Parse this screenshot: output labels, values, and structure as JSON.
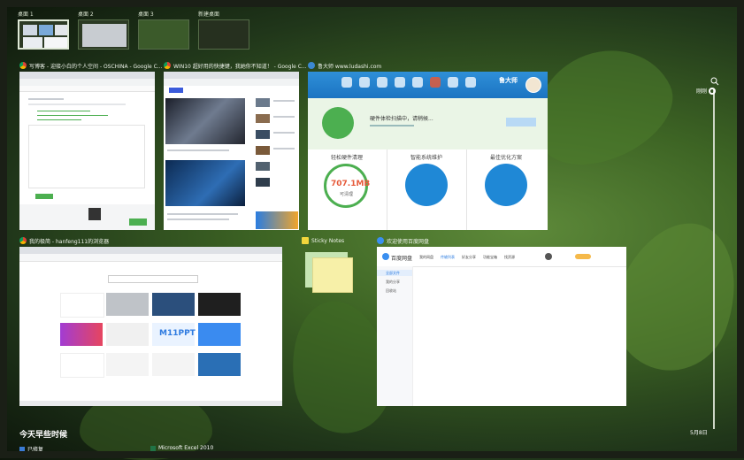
{
  "desktops": [
    {
      "label": "桌面 1"
    },
    {
      "label": "桌面 2"
    },
    {
      "label": "桌面 3"
    },
    {
      "label": "新建桌面"
    }
  ],
  "windows": {
    "oschina": {
      "title": "写博客 - 迎接小白的个人空间 - OSCHINA - Google C..."
    },
    "win10": {
      "title": "WIN10 超好用的快捷键，我她你不知道！ - Google C..."
    },
    "ludashi": {
      "title": "鲁大师 www.ludashi.com",
      "brand": "鲁大师",
      "status": "硬件体检扫描中，请稍候...",
      "panels": [
        {
          "title": "轻松硬件清理",
          "value": "707.1MB",
          "sub": "可清理"
        },
        {
          "title": "智能系统维护"
        },
        {
          "title": "最佳优化方案"
        }
      ]
    },
    "browser": {
      "title": "我的极简 - hanfeng111的浏览器",
      "tile_text": "M11PPT"
    },
    "sticky": {
      "title": "Sticky Notes"
    },
    "baidu": {
      "title": "欢迎使用百度网盘",
      "logo": "百度网盘",
      "tabs": [
        "我的网盘",
        "传输列表",
        "好友分享",
        "功能宝箱",
        "找资源"
      ],
      "sidebar": [
        "全部文件",
        "我的分享",
        "回收站"
      ]
    }
  },
  "timeline": {
    "top_label": "刚刚",
    "bottom_label": "5月8日"
  },
  "section_label": "今天早些时候",
  "bottom_items": [
    {
      "label": "已修复"
    },
    {
      "label": "Microsoft Excel 2010"
    }
  ]
}
